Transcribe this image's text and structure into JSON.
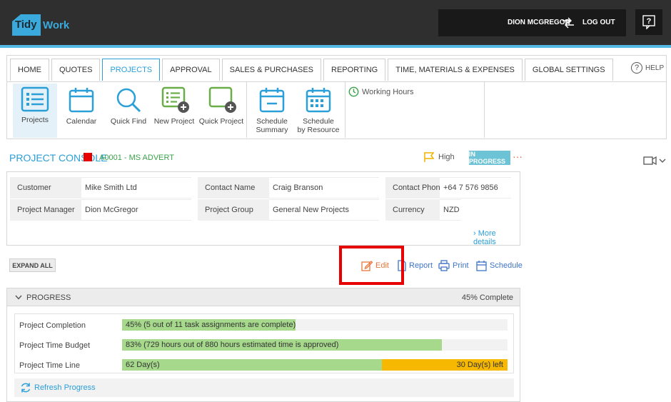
{
  "app": {
    "logo_part1": "Tidy",
    "logo_part2": "Work"
  },
  "header": {
    "username": "DION MCGREGOR",
    "logout_label": "LOG OUT",
    "help_glyph": "?"
  },
  "nav": {
    "tabs": [
      {
        "label": "HOME"
      },
      {
        "label": "QUOTES"
      },
      {
        "label": "PROJECTS"
      },
      {
        "label": "APPROVAL"
      },
      {
        "label": "SALES & PURCHASES"
      },
      {
        "label": "REPORTING"
      },
      {
        "label": "TIME, MATERIALS & EXPENSES"
      },
      {
        "label": "GLOBAL SETTINGS"
      }
    ],
    "active_tab": "PROJECTS",
    "help_label": "HELP",
    "help_glyph": "?"
  },
  "toolbar": {
    "items": [
      {
        "label": "Projects",
        "icon": "list-icon"
      },
      {
        "label": "Calendar",
        "icon": "calendar-icon"
      },
      {
        "label": "Quick Find",
        "icon": "search-icon"
      },
      {
        "label": "New Project",
        "icon": "new-project-icon"
      },
      {
        "label": "Quick Project",
        "icon": "quick-project-icon"
      },
      {
        "label_line1": "Schedule",
        "label_line2": "Summary",
        "icon": "schedule-summary-icon"
      },
      {
        "label_line1": "Schedule",
        "label_line2": "by Resource",
        "icon": "schedule-resource-icon"
      }
    ],
    "working_hours": "Working Hours"
  },
  "console": {
    "title": "PROJECT CONSOLE",
    "project_code": "A0001 - MS ADVERT",
    "priority": "High",
    "status": "IN PROGRESS",
    "more_glyph": "···"
  },
  "info": {
    "customer_label": "Customer",
    "customer_value": "Mike Smith Ltd",
    "contact_name_label": "Contact Name",
    "contact_name_value": "Craig Branson",
    "contact_phone_label": "Contact Phone",
    "contact_phone_value": "+64 7 576 9856",
    "project_manager_label": "Project Manager",
    "project_manager_value": "Dion McGregor",
    "project_group_label": "Project Group",
    "project_group_value": "General New Projects",
    "currency_label": "Currency",
    "currency_value": "NZD",
    "more_details": "More details"
  },
  "actions": {
    "expand_all": "EXPAND ALL",
    "edit": "Edit",
    "report": "Report",
    "print": "Print",
    "schedule": "Schedule"
  },
  "progress": {
    "title": "PROGRESS",
    "summary": "45% Complete",
    "rows": [
      {
        "label": "Project Completion",
        "text": "45% (5 out of 11 task assignments are complete)",
        "fraction": 0.45
      },
      {
        "label": "Project Time Budget",
        "text": "83% (729 hours out of 880 hours estimated time is approved)",
        "fraction": 0.83
      },
      {
        "label": "Project Time Line",
        "text": "62 Day(s)",
        "remaining_text": "30 Day(s) left",
        "fraction": 0.674
      }
    ],
    "refresh_label": "Refresh Progress"
  },
  "colors": {
    "accent": "#2a9fd8",
    "progress_fill": "#a6d98c",
    "timeline_remaining": "#f6b800",
    "highlight": "#e60000",
    "edit": "#e8763a"
  }
}
